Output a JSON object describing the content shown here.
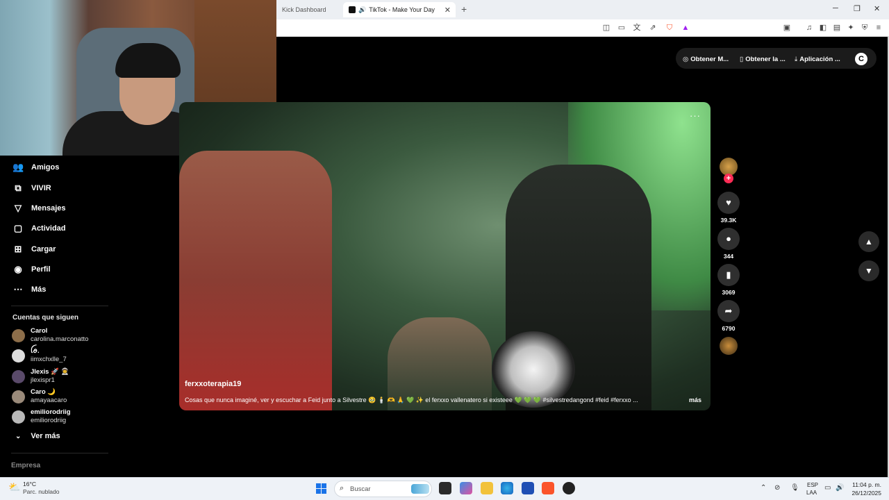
{
  "browser": {
    "tabs": [
      {
        "label": "Kick Dashboard",
        "active": false
      },
      {
        "label": "TikTok - Make Your Day",
        "active": true
      }
    ],
    "new_tab": "+",
    "window_controls": {
      "minimize": "─",
      "restore": "❐",
      "close": "✕"
    }
  },
  "header_pill": {
    "items": [
      {
        "label": "Obtener M...",
        "icon": "coin-icon"
      },
      {
        "label": "Obtener la ...",
        "icon": "phone-icon"
      },
      {
        "label": "Aplicación ...",
        "icon": "download-icon"
      }
    ],
    "avatar_letter": "C"
  },
  "sidebar": {
    "nav": [
      {
        "label": "Amigos",
        "icon": "friends-icon"
      },
      {
        "label": "VIVIR",
        "icon": "live-icon"
      },
      {
        "label": "Mensajes",
        "icon": "messages-icon"
      },
      {
        "label": "Actividad",
        "icon": "activity-icon"
      },
      {
        "label": "Cargar",
        "icon": "upload-icon"
      },
      {
        "label": "Perfil",
        "icon": "profile-icon"
      },
      {
        "label": "Más",
        "icon": "more-icon"
      }
    ],
    "following_title": "Cuentas que siguen",
    "following": [
      {
        "name": "Carol",
        "handle": "carolina.marconatto"
      },
      {
        "name": "ꪶꪮ.",
        "handle": "iimxchxlle_7"
      },
      {
        "name": "Jlexis 🚀 👨‍🚀",
        "handle": "jlexispr1"
      },
      {
        "name": "Caro 🌙",
        "handle": "amayaacaro"
      },
      {
        "name": "emiliorodriig",
        "handle": "emiliorodriig"
      }
    ],
    "see_more": "Ver más",
    "company": "Empresa"
  },
  "video": {
    "author": "ferxxoterapia19",
    "caption": "Cosas que nunca imaginé, ver y escuchar a Feid junto a Silvestre 🥹 🕯️ 🫶 🙏 💚 ✨ el ferxxo vallenatero si existeee 💚 💚 💚 #silvestredangond #feid #ferxxo ...",
    "more": "más",
    "menu": "···"
  },
  "actions": {
    "likes": "39.3K",
    "comments": "344",
    "saves": "3069",
    "shares": "6790"
  },
  "taskbar": {
    "temperature": "16°C",
    "condition": "Parc. nublado",
    "search_placeholder": "Buscar",
    "lang_line1": "ESP",
    "lang_line2": "LAA",
    "time": "11:04 p. m.",
    "date": "26/12/2025"
  },
  "colors": {
    "accent": "#fe2c55",
    "background": "#000000",
    "taskbar": "#eef2f7"
  }
}
